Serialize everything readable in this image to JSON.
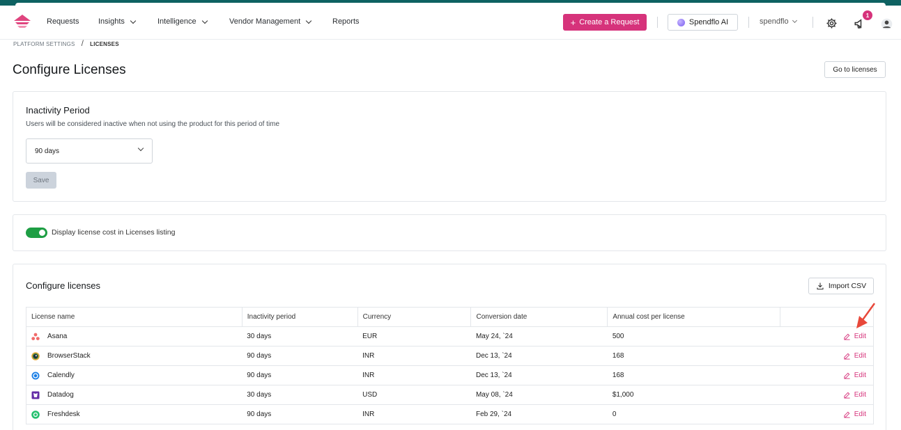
{
  "nav": {
    "items": [
      {
        "label": "Requests",
        "dropdown": false
      },
      {
        "label": "Insights",
        "dropdown": true
      },
      {
        "label": "Intelligence",
        "dropdown": true
      },
      {
        "label": "Vendor Management",
        "dropdown": true
      },
      {
        "label": "Reports",
        "dropdown": false
      }
    ],
    "create_label": "Create a Request",
    "ai_label": "Spendflo AI",
    "org_label": "spendflo",
    "notification_count": "1"
  },
  "breadcrumb": {
    "parent": "PLATFORM SETTINGS",
    "separator": "/",
    "current": "LICENSES"
  },
  "page": {
    "title": "Configure Licenses",
    "goto_label": "Go to licenses"
  },
  "inactivity": {
    "title": "Inactivity Period",
    "hint": "Users will be considered inactive when not using the product for this period of time",
    "selected": "90 days",
    "save_label": "Save"
  },
  "display_cost": {
    "label": "Display license cost in Licenses listing",
    "enabled": true
  },
  "licenses": {
    "title": "Configure licenses",
    "import_label": "Import CSV",
    "columns": [
      "License name",
      "Inactivity period",
      "Currency",
      "Conversion date",
      "Annual cost per license"
    ],
    "edit_label": "Edit",
    "rows": [
      {
        "name": "Asana",
        "icon": "asana-icon",
        "period": "30 days",
        "currency": "EUR",
        "date": "May 24, `24",
        "cost": "500"
      },
      {
        "name": "BrowserStack",
        "icon": "browserstack-icon",
        "period": "90 days",
        "currency": "INR",
        "date": "Dec 13, `24",
        "cost": "168"
      },
      {
        "name": "Calendly",
        "icon": "calendly-icon",
        "period": "90 days",
        "currency": "INR",
        "date": "Dec 13, `24",
        "cost": "168"
      },
      {
        "name": "Datadog",
        "icon": "datadog-icon",
        "period": "30 days",
        "currency": "USD",
        "date": "May 08, `24",
        "cost": "$1,000"
      },
      {
        "name": "Freshdesk",
        "icon": "freshdesk-icon",
        "period": "90 days",
        "currency": "INR",
        "date": "Feb 29, `24",
        "cost": "0"
      }
    ]
  },
  "colors": {
    "accent": "#d6337b",
    "toggle_on": "#1e9e44",
    "topbar": "#0e6262"
  }
}
